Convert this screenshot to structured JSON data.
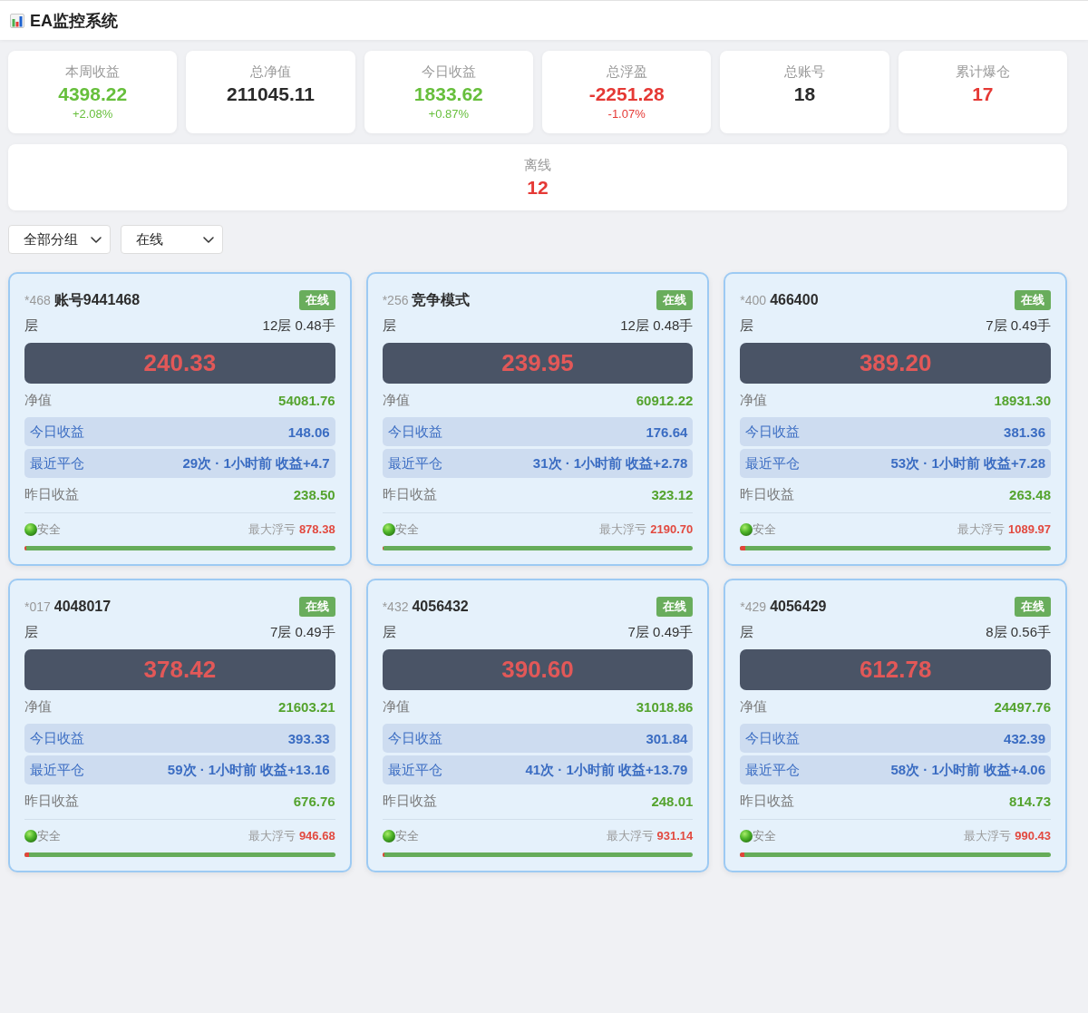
{
  "header": {
    "title": "EA监控系统"
  },
  "stats": [
    {
      "label": "本周收益",
      "value": "4398.22",
      "change": "+2.08%",
      "color": "#67bf3c"
    },
    {
      "label": "总净值",
      "value": "211045.11",
      "color": "#2a2a2a"
    },
    {
      "label": "今日收益",
      "value": "1833.62",
      "change": "+0.87%",
      "color": "#67bf3c"
    },
    {
      "label": "总浮盈",
      "value": "-2251.28",
      "change": "-1.07%",
      "color": "#e53935"
    },
    {
      "label": "总账号",
      "value": "18",
      "color": "#2a2a2a"
    },
    {
      "label": "累计爆仓",
      "value": "17",
      "color": "#e53935"
    },
    {
      "label": "离线",
      "value": "12",
      "color": "#e53935"
    }
  ],
  "filters": [
    {
      "value": "全部分组"
    },
    {
      "value": "在线"
    }
  ],
  "accounts": [
    {
      "tag": "*468",
      "name": "账号9441468",
      "status": "在线",
      "online": true,
      "layer_label": "层",
      "layers": "12层 0.48手",
      "floating": "240.33",
      "rows": [
        {
          "label": "净值",
          "value": "54081.76",
          "kind": "plain"
        },
        {
          "label": "今日收益",
          "value": "148.06",
          "kind": "highlight"
        },
        {
          "label": "最近平仓",
          "value": "29次 · 1小时前 收益+4.7",
          "kind": "highlight"
        },
        {
          "label": "昨日收益",
          "value": "238.50",
          "kind": "plain"
        }
      ],
      "risk": "安全",
      "max_loss_label": "最大浮亏",
      "max_loss": "878.38",
      "level": 0.005
    },
    {
      "tag": "*256",
      "name": "竞争模式",
      "status": "在线",
      "online": true,
      "layer_label": "层",
      "layers": "12层 0.48手",
      "floating": "239.95",
      "rows": [
        {
          "label": "净值",
          "value": "60912.22",
          "kind": "plain"
        },
        {
          "label": "今日收益",
          "value": "176.64",
          "kind": "highlight"
        },
        {
          "label": "最近平仓",
          "value": "31次 · 1小时前 收益+2.78",
          "kind": "highlight"
        },
        {
          "label": "昨日收益",
          "value": "323.12",
          "kind": "plain"
        }
      ],
      "risk": "安全",
      "max_loss_label": "最大浮亏",
      "max_loss": "2190.70",
      "level": 0.005
    },
    {
      "tag": "*400",
      "name": "466400",
      "status": "在线",
      "online": true,
      "layer_label": "层",
      "layers": "7层 0.49手",
      "floating": "389.20",
      "rows": [
        {
          "label": "净值",
          "value": "18931.30",
          "kind": "plain"
        },
        {
          "label": "今日收益",
          "value": "381.36",
          "kind": "highlight"
        },
        {
          "label": "最近平仓",
          "value": "53次 · 1小时前 收益+7.28",
          "kind": "highlight"
        },
        {
          "label": "昨日收益",
          "value": "263.48",
          "kind": "plain"
        }
      ],
      "risk": "安全",
      "max_loss_label": "最大浮亏",
      "max_loss": "1089.97",
      "level": 0.018
    },
    {
      "tag": "*017",
      "name": "4048017",
      "status": "在线",
      "online": true,
      "layer_label": "层",
      "layers": "7层 0.49手",
      "floating": "378.42",
      "rows": [
        {
          "label": "净值",
          "value": "21603.21",
          "kind": "plain"
        },
        {
          "label": "今日收益",
          "value": "393.33",
          "kind": "highlight"
        },
        {
          "label": "最近平仓",
          "value": "59次 · 1小时前 收益+13.16",
          "kind": "highlight"
        },
        {
          "label": "昨日收益",
          "value": "676.76",
          "kind": "plain"
        }
      ],
      "risk": "安全",
      "max_loss_label": "最大浮亏",
      "max_loss": "946.68",
      "level": 0.015
    },
    {
      "tag": "*432",
      "name": "4056432",
      "status": "在线",
      "online": true,
      "layer_label": "层",
      "layers": "7层 0.49手",
      "floating": "390.60",
      "rows": [
        {
          "label": "净值",
          "value": "31018.86",
          "kind": "plain"
        },
        {
          "label": "今日收益",
          "value": "301.84",
          "kind": "highlight"
        },
        {
          "label": "最近平仓",
          "value": "41次 · 1小时前 收益+13.79",
          "kind": "highlight"
        },
        {
          "label": "昨日收益",
          "value": "248.01",
          "kind": "plain"
        }
      ],
      "risk": "安全",
      "max_loss_label": "最大浮亏",
      "max_loss": "931.14",
      "level": 0.008
    },
    {
      "tag": "*429",
      "name": "4056429",
      "status": "在线",
      "online": true,
      "layer_label": "层",
      "layers": "8层 0.56手",
      "floating": "612.78",
      "rows": [
        {
          "label": "净值",
          "value": "24497.76",
          "kind": "plain"
        },
        {
          "label": "今日收益",
          "value": "432.39",
          "kind": "highlight"
        },
        {
          "label": "最近平仓",
          "value": "58次 · 1小时前 收益+4.06",
          "kind": "highlight"
        },
        {
          "label": "昨日收益",
          "value": "814.73",
          "kind": "plain"
        }
      ],
      "risk": "安全",
      "max_loss_label": "最大浮亏",
      "max_loss": "990.43",
      "level": 0.015
    }
  ]
}
